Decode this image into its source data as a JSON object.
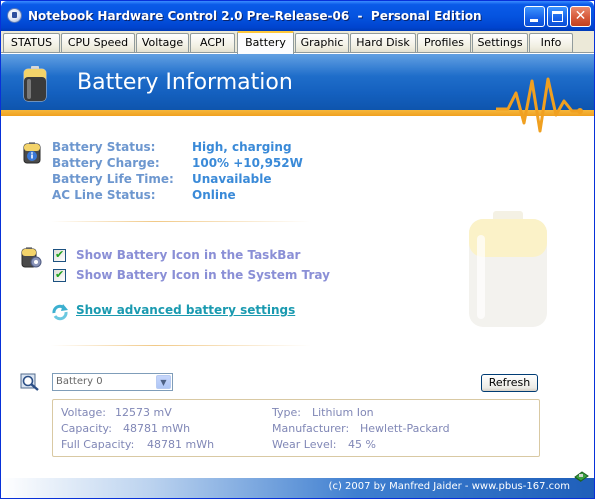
{
  "window": {
    "title": "Notebook Hardware Control 2.0 Pre-Release-06  -  Personal Edition",
    "buttons": {
      "minimize": "minimize",
      "maximize": "maximize",
      "close": "✕"
    }
  },
  "tabs": [
    {
      "label": "STATUS"
    },
    {
      "label": "CPU Speed"
    },
    {
      "label": "Voltage"
    },
    {
      "label": "ACPI"
    },
    {
      "label": "Battery",
      "active": true
    },
    {
      "label": "Graphic"
    },
    {
      "label": "Hard Disk"
    },
    {
      "label": "Profiles"
    },
    {
      "label": "Settings"
    },
    {
      "label": "Info"
    }
  ],
  "header": {
    "title": "Battery Information",
    "accent_color": "#f0a020"
  },
  "status": {
    "items": [
      {
        "label": "Battery Status:",
        "value": "High, charging"
      },
      {
        "label": "Battery Charge:",
        "value": "100%  +10,952W"
      },
      {
        "label": "Battery Life Time:",
        "value": "Unavailable"
      },
      {
        "label": "AC Line Status:",
        "value": "Online"
      }
    ]
  },
  "options": {
    "taskbar_icon": {
      "label": "Show Battery Icon in the TaskBar",
      "checked": true
    },
    "tray_icon": {
      "label": "Show Battery Icon in the System Tray",
      "checked": true
    },
    "advanced_link": "Show advanced battery settings"
  },
  "battery_select": {
    "selected": "Battery 0"
  },
  "refresh_label": "Refresh",
  "details": {
    "voltage_label": "Voltage:",
    "voltage": "12573 mV",
    "capacity_label": "Capacity:",
    "capacity": "48781 mWh",
    "full_capacity_label": "Full Capacity:",
    "full_capacity": "48781 mWh",
    "type_label": "Type:",
    "type": "Lithium Ion",
    "manufacturer_label": "Manufacturer:",
    "manufacturer": "Hewlett-Packard",
    "wear_label": "Wear Level:",
    "wear": "45 %"
  },
  "footer": {
    "copyright": "(c) 2007 by Manfred Jaider - www.pbus-167.com"
  }
}
